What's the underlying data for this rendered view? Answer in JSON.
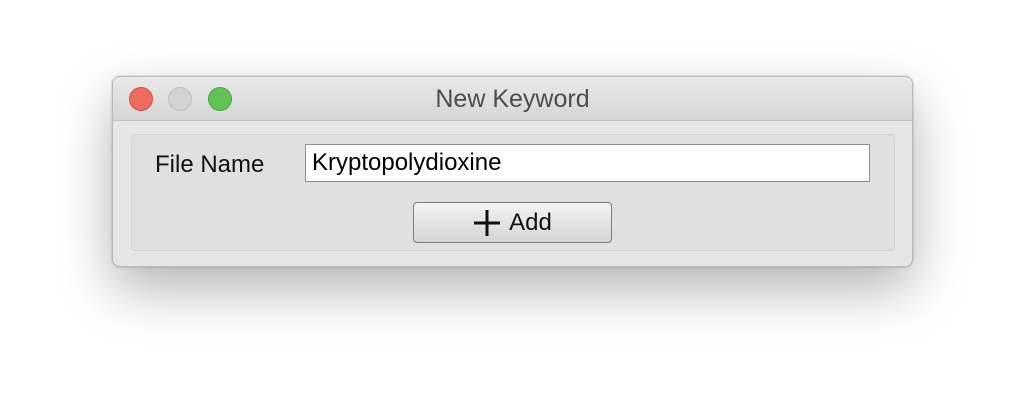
{
  "window": {
    "title": "New Keyword"
  },
  "form": {
    "file_name_label": "File Name",
    "file_name_value": "Kryptopolydioxine"
  },
  "actions": {
    "add_label": "Add",
    "add_icon": "plus-icon"
  },
  "colors": {
    "close": "#ee6a5e",
    "minimize": "#d3d3d3",
    "zoom": "#5fc454"
  }
}
